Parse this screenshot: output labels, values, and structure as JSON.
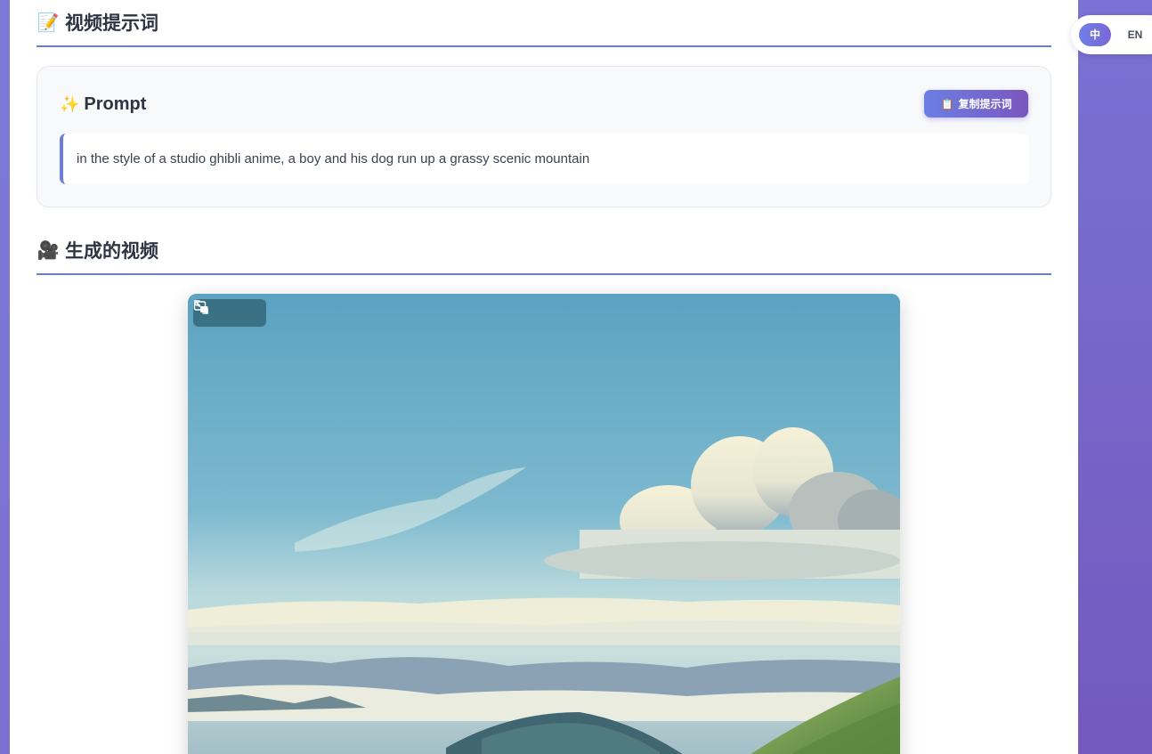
{
  "language_switch": {
    "zh_label": "中",
    "en_label": "EN",
    "active": "zh"
  },
  "prompt_section": {
    "icon": "memo-icon",
    "icon_glyph": "📝",
    "title": "视频提示词"
  },
  "prompt_card": {
    "icon": "sparkles-icon",
    "icon_glyph": "✨",
    "title": "Prompt",
    "copy_button": {
      "icon": "clipboard-icon",
      "icon_glyph": "📋",
      "label": "复制提示词"
    },
    "prompt_text": "in the style of a studio ghibli anime, a boy and his dog run up a grassy scenic mountain"
  },
  "video_section": {
    "icon": "movie-camera-icon",
    "icon_glyph": "🎥",
    "title": "生成的视频"
  },
  "video_player": {
    "controls": [
      "fullscreen-icon",
      "picture-in-picture-icon"
    ]
  },
  "colors": {
    "accent": "#6a7ee0",
    "background_gradient_start": "#7b73d6",
    "background_gradient_end": "#7459be",
    "title_text": "#2d3442"
  }
}
